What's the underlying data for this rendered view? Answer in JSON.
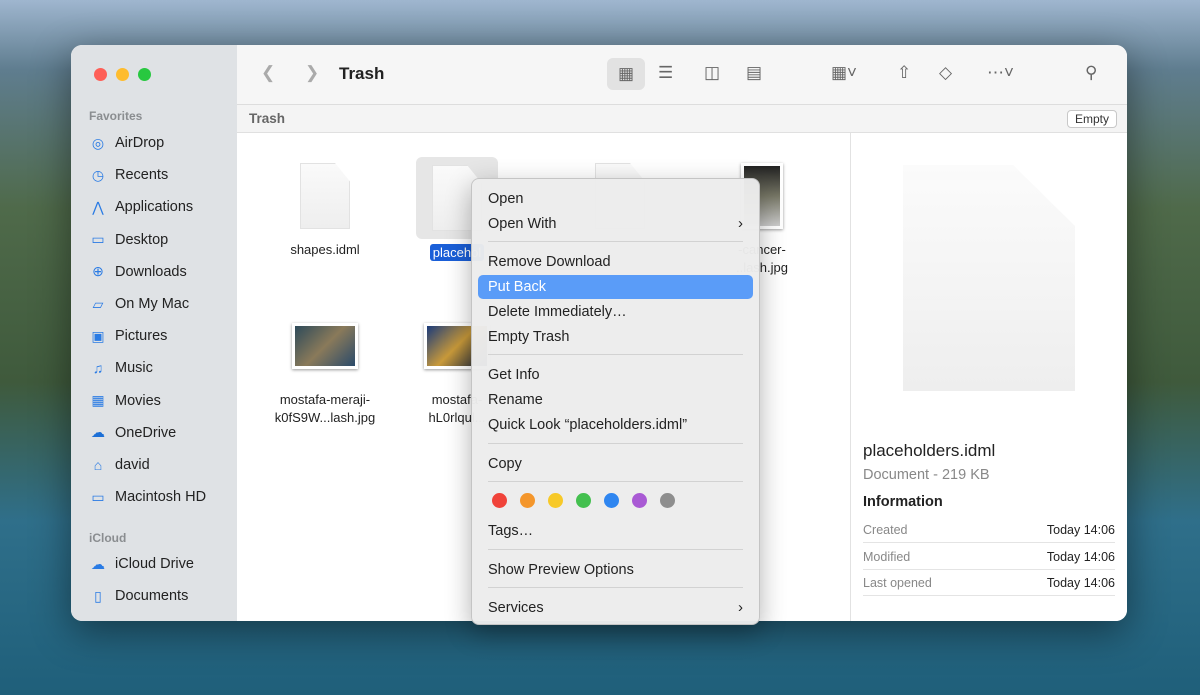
{
  "window": {
    "title": "Trash",
    "path": "Trash",
    "empty_button": "Empty"
  },
  "sidebar": {
    "favorites_label": "Favorites",
    "favorites": [
      {
        "label": "AirDrop",
        "icon": "airdrop-icon"
      },
      {
        "label": "Recents",
        "icon": "clock-icon"
      },
      {
        "label": "Applications",
        "icon": "applications-icon"
      },
      {
        "label": "Desktop",
        "icon": "desktop-icon"
      },
      {
        "label": "Downloads",
        "icon": "download-icon"
      },
      {
        "label": "On My Mac",
        "icon": "folder-icon"
      },
      {
        "label": "Pictures",
        "icon": "pictures-icon"
      },
      {
        "label": "Music",
        "icon": "music-icon"
      },
      {
        "label": "Movies",
        "icon": "film-icon"
      },
      {
        "label": "OneDrive",
        "icon": "cloud-icon"
      },
      {
        "label": "david",
        "icon": "home-icon"
      },
      {
        "label": "Macintosh HD",
        "icon": "drive-icon"
      }
    ],
    "icloud_label": "iCloud",
    "icloud": [
      {
        "label": "iCloud Drive",
        "icon": "cloud-icon"
      },
      {
        "label": "Documents",
        "icon": "document-icon"
      }
    ]
  },
  "files": [
    {
      "name": "shapes.idml",
      "type": "doc"
    },
    {
      "name": "placehol",
      "type": "doc",
      "selected": true
    },
    {
      "name": "",
      "type": "doc"
    },
    {
      "name": "-cancer-\n..lash.jpg",
      "line1": "-cancer-",
      "line2": "..lash.jpg",
      "type": "image"
    },
    {
      "line1": "mostafa-meraji-",
      "line2": "k0fS9W...lash.jpg",
      "type": "image"
    },
    {
      "line1": "mostafa-",
      "line2": "hL0rlqul...",
      "type": "image"
    }
  ],
  "menu": {
    "items": [
      "Open",
      "Open With",
      "Remove Download",
      "Put Back",
      "Delete Immediately…",
      "Empty Trash",
      "Get Info",
      "Rename",
      "Quick Look “placeholders.idml”",
      "Copy",
      "Tags…",
      "Show Preview Options",
      "Services"
    ],
    "highlighted": "Put Back",
    "tag_colors": [
      "#f0433a",
      "#f4962b",
      "#f7c928",
      "#44c04f",
      "#2f86f0",
      "#a95ad4",
      "#8e8e8e"
    ]
  },
  "preview": {
    "name": "placeholders.idml",
    "kind": "Document - 219 KB",
    "info_label": "Information",
    "rows": [
      {
        "label": "Created",
        "value": "Today 14:06"
      },
      {
        "label": "Modified",
        "value": "Today 14:06"
      },
      {
        "label": "Last opened",
        "value": "Today 14:06"
      }
    ]
  }
}
